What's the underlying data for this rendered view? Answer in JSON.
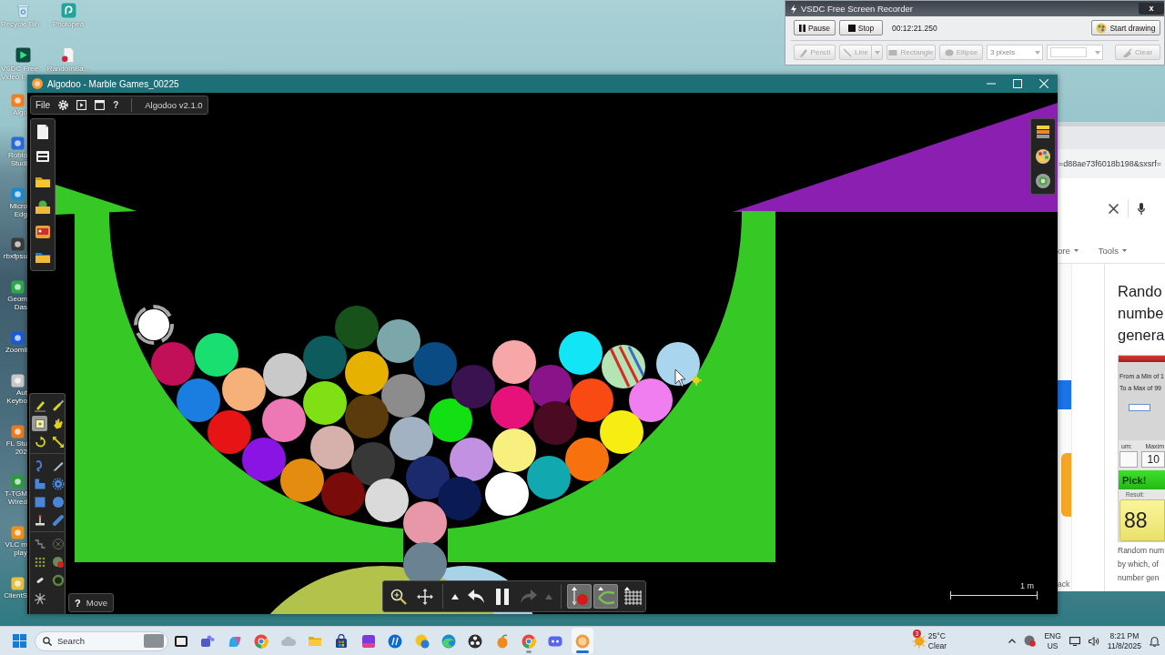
{
  "desktop": {
    "icons": [
      {
        "label": "Recycle Bin"
      },
      {
        "label": "Photopea"
      },
      {
        "label": "VSDC Free Video E"
      },
      {
        "label": "RandomBa..."
      }
    ],
    "edge_icons": [
      {
        "label": "Algo"
      },
      {
        "label": "Roblo Studi"
      },
      {
        "label": "Micro Edg"
      },
      {
        "label": "rbxfpsu"
      },
      {
        "label": "Geom Das"
      },
      {
        "label": "Zoomli"
      },
      {
        "label": "Aut Keybo"
      },
      {
        "label": "FL Stu 202"
      },
      {
        "label": "T-TGM Wired"
      },
      {
        "label": "VLC m play"
      },
      {
        "label": "ClientS"
      }
    ]
  },
  "recorder": {
    "title": "VSDC Free Screen Recorder",
    "close": "x",
    "pause": "Pause",
    "stop": "Stop",
    "elapsed": "00:12:21.250",
    "start_drawing": "Start drawing",
    "drawing_tools": [
      {
        "kind": "pencil",
        "label": "Pencil",
        "disabled": true
      },
      {
        "kind": "line",
        "label": "Line",
        "disabled": true
      },
      {
        "kind": "rectangle",
        "label": "Rectangle",
        "disabled": true
      },
      {
        "kind": "ellipse",
        "label": "Ellipse",
        "disabled": true
      }
    ],
    "brush_size": {
      "value": "3 pixels",
      "disabled": true
    },
    "color": {
      "disabled": true
    },
    "clear": {
      "label": "Clear",
      "disabled": true
    }
  },
  "algodoo": {
    "title": "Algodoo - Marble Games_00225",
    "menu": {
      "file": "File",
      "help": "?",
      "version": "Algodoo v2.1.0"
    },
    "tools": [
      {
        "selected": false
      },
      {
        "selected": false
      },
      {
        "selected": true
      },
      {
        "selected": false
      },
      {
        "selected": false
      },
      {
        "selected": false
      },
      {
        "selected": false
      },
      {
        "selected": false
      },
      {
        "selected": false
      },
      {
        "selected": false
      },
      {
        "selected": false
      },
      {
        "selected": false
      },
      {
        "selected": false
      },
      {
        "selected": false
      },
      {
        "selected": false
      },
      {
        "selected": false
      },
      {
        "selected": false
      },
      {
        "selected": false
      },
      {
        "selected": false
      },
      {
        "selected": false
      },
      {
        "selected": false
      }
    ],
    "hint": {
      "mark": "?",
      "label": "Move"
    },
    "view_controls": [
      {
        "kind": "zoom"
      },
      {
        "kind": "pan"
      }
    ],
    "history": [
      {
        "kind": "caret",
        "disabled": false
      },
      {
        "kind": "undo",
        "disabled": false
      },
      {
        "kind": "pause",
        "disabled": false
      },
      {
        "kind": "redo",
        "disabled": true
      },
      {
        "kind": "caret",
        "disabled": true
      }
    ],
    "toggles": [
      {
        "kind": "gravity",
        "on": true
      },
      {
        "kind": "air",
        "on": true
      },
      {
        "kind": "grid",
        "on": false
      }
    ],
    "scale": "1 m"
  },
  "browser": {
    "url": "=d88ae73f6018b198&sxsrf=",
    "filters": [
      {
        "label": "ore"
      },
      {
        "label": "Tools"
      }
    ],
    "heading_lines": [
      "Rando",
      "numbe",
      "genera"
    ],
    "generator": {
      "min_label": "From a Min of 1",
      "max_label": "To a Max of 99",
      "column_1": "um:",
      "column_2": "Maxim",
      "max_value": "10",
      "button": "Pick!",
      "result_label": "Result:",
      "result": "88"
    },
    "snippet_lines": [
      "Random num",
      "by which, of",
      "number gen"
    ],
    "back": "ack"
  },
  "taskbar": {
    "search": {
      "placeholder": "Search"
    },
    "apps": [
      {
        "open": false,
        "selected": false
      },
      {
        "open": false,
        "selected": false
      },
      {
        "open": false,
        "selected": false
      },
      {
        "open": false,
        "selected": false
      },
      {
        "open": false,
        "selected": false
      },
      {
        "open": false,
        "selected": false
      },
      {
        "open": false,
        "selected": false
      },
      {
        "open": false,
        "selected": false
      },
      {
        "open": false,
        "selected": false
      },
      {
        "open": false,
        "selected": false
      },
      {
        "open": false,
        "selected": false
      },
      {
        "open": false,
        "selected": false
      },
      {
        "open": false,
        "selected": false
      },
      {
        "open": true,
        "selected": false
      },
      {
        "open": false,
        "selected": false
      },
      {
        "open": true,
        "selected": true
      }
    ],
    "weather": {
      "badge": "3",
      "temperature": "25°C",
      "condition": "Clear"
    },
    "language": {
      "code": "ENG",
      "region": "US"
    },
    "clock": {
      "time": "8:21 PM",
      "date": "11/8/2025"
    }
  }
}
